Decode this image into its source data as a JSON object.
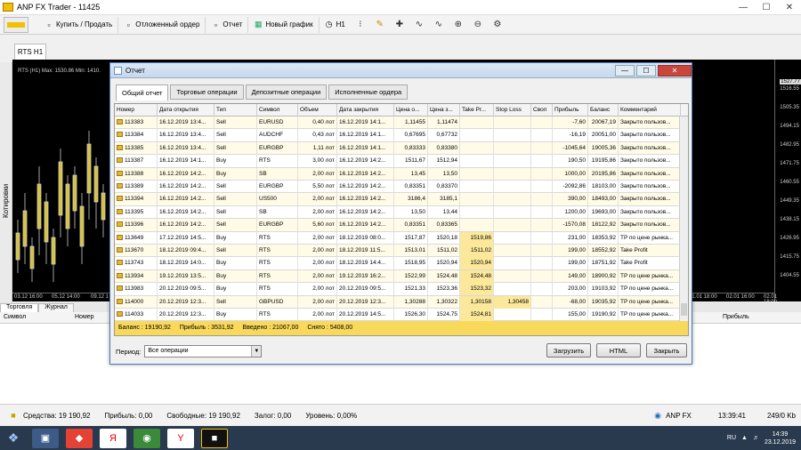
{
  "window": {
    "title": "ANP FX Trader - 11425"
  },
  "toolbar": {
    "buy_sell": "Купить / Продать",
    "pending": "Отложенный ордер",
    "report": "Отчет",
    "new_chart": "Новый график",
    "timeframe": "H1"
  },
  "chart": {
    "tab_label": "RTS  H1",
    "info": "RTS (H1)  Max: 1530.86  Min: 1410.",
    "side_label": "Котировки",
    "prices": [
      "1527.77",
      "1516.55",
      "1505.35",
      "1494.15",
      "1482.95",
      "1471.75",
      "1460.55",
      "1449.35",
      "1438.15",
      "1426.95",
      "1415.75",
      "1404.55"
    ],
    "current_price": "1527.77",
    "time_labels": [
      "03.12 16:00",
      "05.12 14:00",
      "09.12 1",
      "01.01 18:00",
      "02.01 16:00",
      "02.01 18:00"
    ]
  },
  "terminal": {
    "tabs": [
      "Торговля",
      "Журнал"
    ],
    "col_symbol": "Символ",
    "col_number": "Номер",
    "col_profit": "Прибыль"
  },
  "status": {
    "funds": "Средства: 19 190,92",
    "profit": "Прибыль: 0,00",
    "free": "Свободные: 19 190,92",
    "margin": "Залог: 0,00",
    "level": "Уровень: 0,00%",
    "server": "ANP FX",
    "time": "13:39:41",
    "traffic": "249/0 Kb"
  },
  "taskbar": {
    "lang": "RU",
    "clock_time": "14:39",
    "clock_date": "23.12.2019"
  },
  "dialog": {
    "title": "Отчет",
    "close_glyph": "✕",
    "tabs": [
      "Общий отчет",
      "Торговые операции",
      "Депозитные операции",
      "Исполненные ордера"
    ],
    "columns": [
      "Номер",
      "Дата открытия",
      "Тип",
      "Символ",
      "Объем",
      "Дата закрытия",
      "Цена о...",
      "Цена з...",
      "Take Pr...",
      "Stop Loss",
      "Своп",
      "Прибыль",
      "Баланс",
      "Комментарий"
    ],
    "rows": [
      [
        "113383",
        "16.12.2019 13:4...",
        "Sell",
        "EURUSD",
        "0,40 лот",
        "16.12.2019 14:1...",
        "1,11455",
        "1,11474",
        "",
        "",
        "",
        "-7,60",
        "20067,19",
        "Закрыто пользов..."
      ],
      [
        "113384",
        "16.12.2019 13:4...",
        "Sell",
        "AUDCHF",
        "0,43 лот",
        "16.12.2019 14:1...",
        "0,67695",
        "0,67732",
        "",
        "",
        "",
        "-16,19",
        "20051,00",
        "Закрыто пользов..."
      ],
      [
        "113385",
        "16.12.2019 13:4...",
        "Sell",
        "EURGBP",
        "1,11 лот",
        "16.12.2019 14:1...",
        "0,83333",
        "0,83380",
        "",
        "",
        "",
        "-1045,64",
        "19005,36",
        "Закрыто пользов..."
      ],
      [
        "113387",
        "16.12.2019 14:1...",
        "Buy",
        "RTS",
        "3,00 лот",
        "16.12.2019 14:2...",
        "1511,67",
        "1512,94",
        "",
        "",
        "",
        "190,50",
        "19195,86",
        "Закрыто пользов..."
      ],
      [
        "113388",
        "16.12.2019 14:2...",
        "Buy",
        "SB",
        "2,00 лот",
        "16.12.2019 14:2...",
        "13,45",
        "13,50",
        "",
        "",
        "",
        "1000,00",
        "20195,86",
        "Закрыто пользов..."
      ],
      [
        "113389",
        "16.12.2019 14:2...",
        "Sell",
        "EURGBP",
        "5,50 лот",
        "16.12.2019 14:2...",
        "0,83351",
        "0,83370",
        "",
        "",
        "",
        "-2092,86",
        "18103,00",
        "Закрыто пользов..."
      ],
      [
        "113394",
        "16.12.2019 14:2...",
        "Sell",
        "US500",
        "2,00 лот",
        "16.12.2019 14:2...",
        "3186,4",
        "3185,1",
        "",
        "",
        "",
        "390,00",
        "18493,00",
        "Закрыто пользов..."
      ],
      [
        "113395",
        "16.12.2019 14:2...",
        "Sell",
        "SB",
        "2,00 лот",
        "16.12.2019 14:2...",
        "13,50",
        "13,44",
        "",
        "",
        "",
        "1200,00",
        "19693,00",
        "Закрыто пользов..."
      ],
      [
        "113396",
        "16.12.2019 14:2...",
        "Sell",
        "EURGBP",
        "5,60 лот",
        "16.12.2019 14:2...",
        "0,83351",
        "0,83365",
        "",
        "",
        "",
        "-1570,08",
        "18122,92",
        "Закрыто пользов..."
      ],
      [
        "113649",
        "17.12.2019 14:5...",
        "Buy",
        "RTS",
        "2,00 лот",
        "18.12.2019 08:0...",
        "1517,87",
        "1520,18",
        "1519,86",
        "",
        "",
        "231,00",
        "18353,92",
        "TP по цене рынка..."
      ],
      [
        "113670",
        "18.12.2019 09:4...",
        "Sell",
        "RTS",
        "2,00 лот",
        "18.12.2019 11:5...",
        "1513,01",
        "1511,02",
        "1511,02",
        "",
        "",
        "199,00",
        "18552,92",
        "Take Profit"
      ],
      [
        "113743",
        "18.12.2019 14:0...",
        "Buy",
        "RTS",
        "2,00 лот",
        "18.12.2019 14:4...",
        "1518,95",
        "1520,94",
        "1520,94",
        "",
        "",
        "199,00",
        "18751,92",
        "Take Profit"
      ],
      [
        "113934",
        "19.12.2019 13:5...",
        "Buy",
        "RTS",
        "2,00 лот",
        "19.12.2019 16:2...",
        "1522,99",
        "1524,48",
        "1524,48",
        "",
        "",
        "149,00",
        "18900,92",
        "TP по цене рынка..."
      ],
      [
        "113983",
        "20.12.2019 09:5...",
        "Buy",
        "RTS",
        "2,00 лот",
        "20.12.2019 09:5...",
        "1521,33",
        "1523,36",
        "1523,32",
        "",
        "",
        "203,00",
        "19103,92",
        "TP по цене рынка..."
      ],
      [
        "114000",
        "20.12.2019 12:3...",
        "Sell",
        "GBPUSD",
        "2,00 лот",
        "20.12.2019 12:3...",
        "1,30288",
        "1,30322",
        "1,30158",
        "1,30458",
        "",
        "-68,00",
        "19035,92",
        "TP по цене рынка..."
      ],
      [
        "114033",
        "20.12.2019 12:3...",
        "Buy",
        "RTS",
        "2,00 лот",
        "20.12.2019 14:5...",
        "1526,30",
        "1524,75",
        "1524,81",
        "",
        "",
        "155,00",
        "19190,92",
        "TP по цене рынка..."
      ]
    ],
    "summary": {
      "balance": "Баланс : 19190,92",
      "profit": "Прибыль : 3531,92",
      "deposited": "Введено : 21067,00",
      "withdrawn": "Снято : 5408,00"
    },
    "period_label": "Период:",
    "period_value": "Все операции",
    "btn_load": "Загрузить",
    "btn_html": "HTML",
    "btn_close": "Закрыть"
  }
}
